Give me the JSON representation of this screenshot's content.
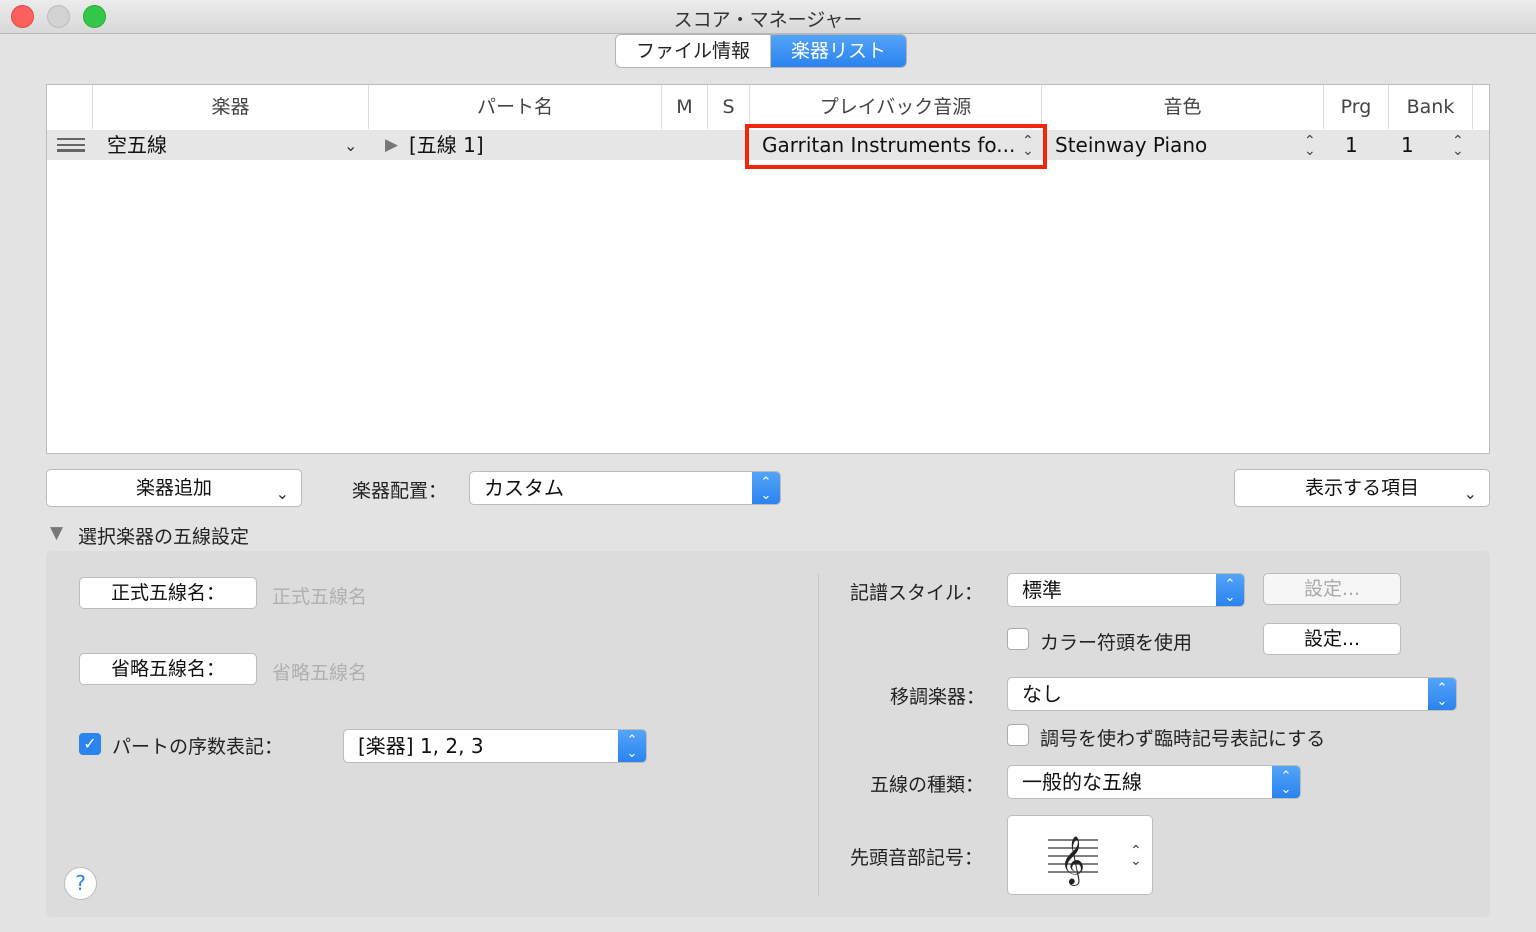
{
  "window": {
    "title": "スコア・マネージャー"
  },
  "tabs": [
    "ファイル情報",
    "楽器リスト"
  ],
  "table": {
    "headers": [
      "楽器",
      "パート名",
      "M",
      "S",
      "プレイバック音源",
      "音色",
      "Prg",
      "Bank"
    ],
    "row": {
      "instrument": "空五線",
      "part": "[五線 1]",
      "playback": "Garritan Instruments fo...",
      "sound": "Steinway Piano",
      "prg": "1",
      "bank": "1"
    }
  },
  "toolbar": {
    "add_instrument": "楽器追加",
    "arrange_label": "楽器配置：",
    "arrange_value": "カスタム",
    "show_items": "表示する項目"
  },
  "section": {
    "title": "選択楽器の五線設定"
  },
  "left": {
    "full_name_button": "正式五線名：",
    "full_name_placeholder": "正式五線名",
    "short_name_button": "省略五線名：",
    "short_name_placeholder": "省略五線名",
    "ordinal_label": "パートの序数表記：",
    "ordinal_value": "[楽器] 1, 2, 3"
  },
  "right": {
    "notation_label": "記譜スタイル：",
    "notation_value": "標準",
    "settings_disabled": "設定...",
    "color_notes_label": "カラー符頭を使用",
    "settings": "設定...",
    "transpose_label": "移調楽器：",
    "transpose_value": "なし",
    "accidentals_label": "調号を使わず臨時記号表記にする",
    "staff_type_label": "五線の種類：",
    "staff_type_value": "一般的な五線",
    "clef_label": "先頭音部記号："
  },
  "help": "?"
}
